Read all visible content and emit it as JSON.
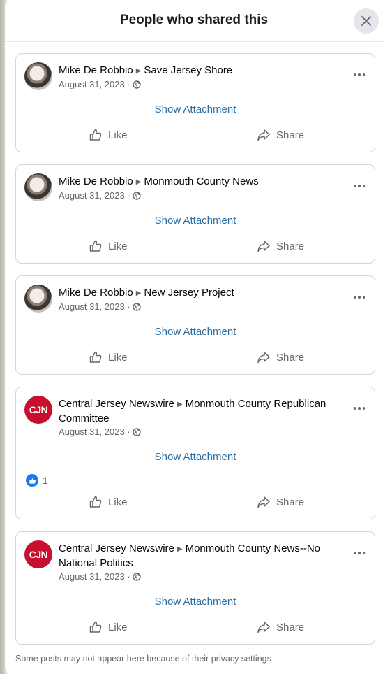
{
  "modal": {
    "title": "People who shared this",
    "close_icon": "close-icon"
  },
  "posts": [
    {
      "author": "Mike De Robbio",
      "target": "Save Jersey Shore",
      "date": "August 31, 2023 ·",
      "avatar": "dog-photo",
      "attachment_label": "Show Attachment",
      "like_label": "Like",
      "share_label": "Share"
    },
    {
      "author": "Mike De Robbio",
      "target": "Monmouth County News",
      "date": "August 31, 2023 ·",
      "avatar": "dog-photo",
      "attachment_label": "Show Attachment",
      "like_label": "Like",
      "share_label": "Share"
    },
    {
      "author": "Mike De Robbio",
      "target": "New Jersey Project",
      "date": "August 31, 2023 ·",
      "avatar": "dog-photo",
      "attachment_label": "Show Attachment",
      "like_label": "Like",
      "share_label": "Share"
    },
    {
      "author": "Central Jersey Newswire",
      "target": "Monmouth County Republican Committee",
      "date": "August 31, 2023 ·",
      "avatar": "CJN",
      "attachment_label": "Show Attachment",
      "reaction_count": "1",
      "like_label": "Like",
      "share_label": "Share"
    },
    {
      "author": "Central Jersey Newswire",
      "target": "Monmouth County News--No National Politics",
      "date": "August 31, 2023 ·",
      "avatar": "CJN",
      "attachment_label": "Show Attachment",
      "like_label": "Like",
      "share_label": "Share"
    }
  ],
  "footer": {
    "note": "Some posts may not appear here because of their privacy settings"
  },
  "colors": {
    "link": "#2a6ea6",
    "like_badge": "#1877f2",
    "cjn_red": "#c8102e"
  }
}
